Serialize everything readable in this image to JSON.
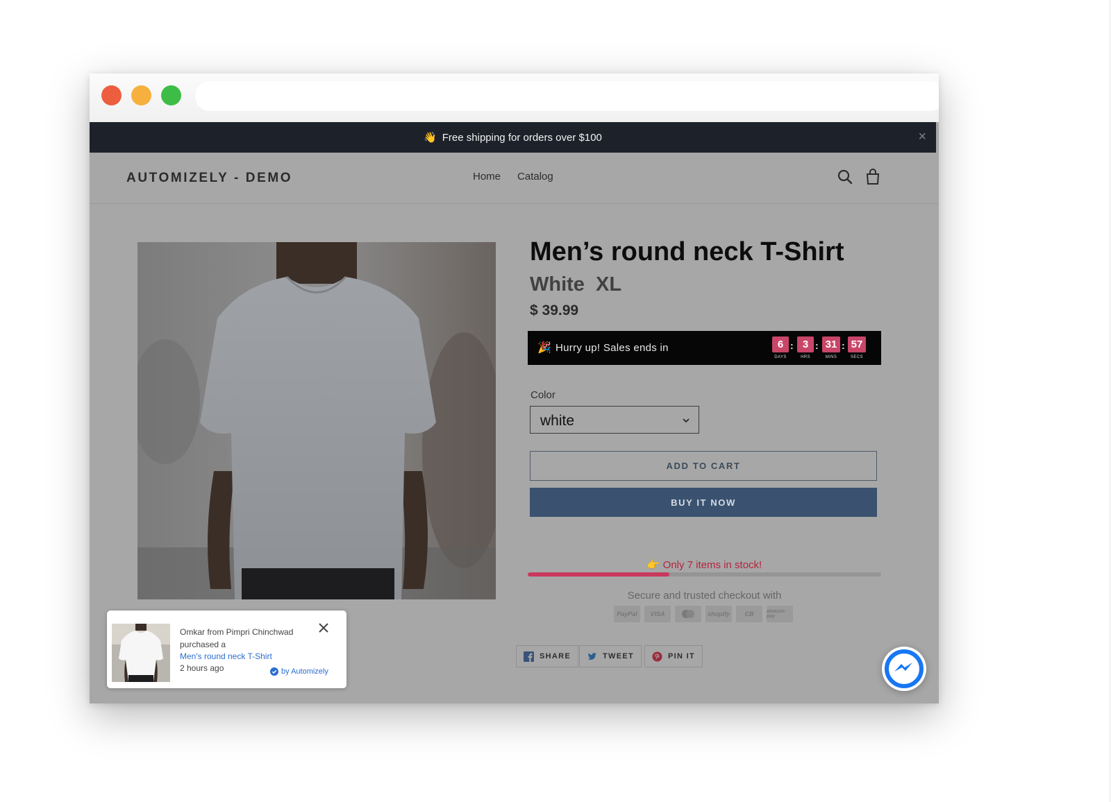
{
  "announcement": {
    "emoji": "👋",
    "text": "Free shipping for orders over $100",
    "close": "×"
  },
  "header": {
    "logo": "AUTOMIZELY - DEMO",
    "nav": [
      "Home",
      "Catalog"
    ],
    "icons": [
      "search-icon",
      "cart-icon"
    ]
  },
  "product": {
    "title": "Men’s round neck T-Shirt",
    "variant": "White  XL",
    "price": "$ 39.99",
    "image_alt": "man-wearing-white-tshirt"
  },
  "timer": {
    "emoji": "🎉",
    "label": "Hurry up! Sales ends in",
    "units": [
      {
        "value": "6",
        "caption": "DAYS"
      },
      {
        "value": "3",
        "caption": "HRS"
      },
      {
        "value": "31",
        "caption": "MINS"
      },
      {
        "value": "57",
        "caption": "SECS"
      }
    ],
    "separator": ":",
    "accent_color": "#c94669"
  },
  "options": {
    "color_label": "Color",
    "color_value": "white"
  },
  "buttons": {
    "add_to_cart": "ADD TO CART",
    "buy_now": "BUY IT NOW"
  },
  "stock": {
    "emoji": "👉",
    "text": "Only 7 items in stock!",
    "progress": 0.4,
    "color": "#c9395d"
  },
  "checkout": {
    "text": "Secure and trusted checkout with",
    "payment_methods": [
      "PayPal",
      "VISA",
      "mastercard",
      "shopify",
      "CB",
      "amazon pay"
    ]
  },
  "social": {
    "share": "SHARE",
    "tweet": "TWEET",
    "pin": "PIN IT"
  },
  "popup": {
    "line1": "Omkar from Pimpri Chinchwad",
    "line2": "purchased a",
    "product_link": "Men's round neck T-Shirt",
    "time": "2 hours ago",
    "by": "by Automizely"
  },
  "colors": {
    "announcement_bg": "#1d222a",
    "page_overlay": "#a7a7a7",
    "buy_button": "#3a5270",
    "messenger": "#1877f2"
  }
}
